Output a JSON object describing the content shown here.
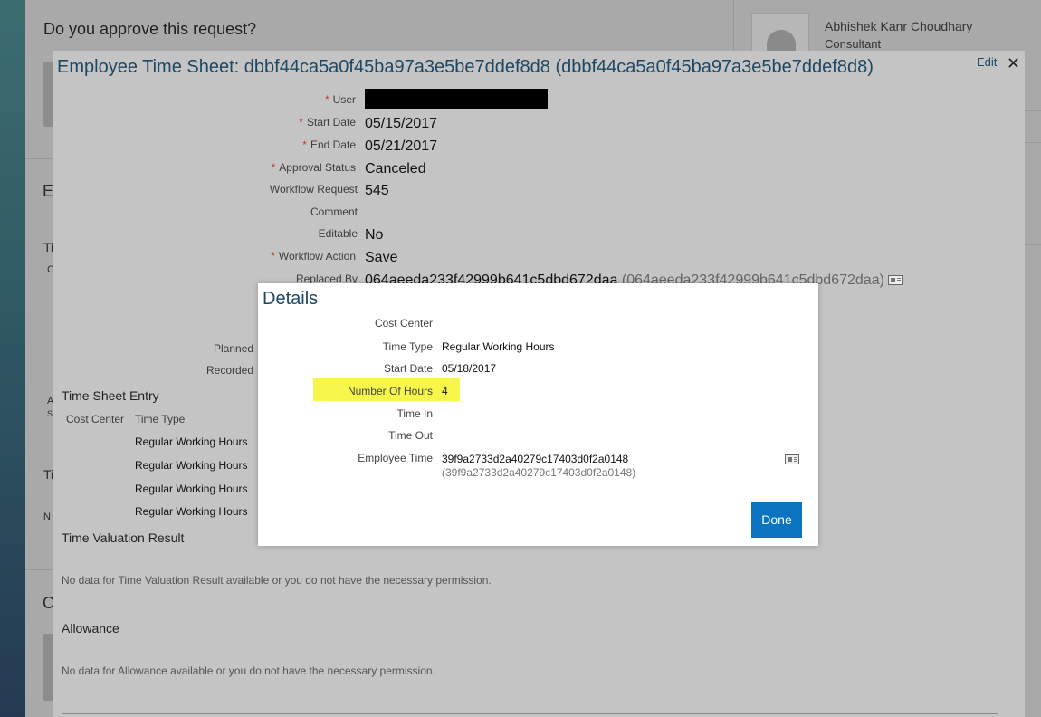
{
  "background": {
    "question": "Do you approve this request?",
    "user_name": "Abhishek Kanr Choudhary",
    "user_role": "Consultant",
    "fragments": [
      "E",
      "Ti",
      "C",
      "A",
      "S",
      "Ti",
      "N",
      "C"
    ]
  },
  "timesheet": {
    "title": "Employee Time Sheet: dbbf44ca5a0f45ba97a3e5be7ddef8d8 (dbbf44ca5a0f45ba97a3e5be7ddef8d8)",
    "edit_label": "Edit",
    "close_glyph": "✕",
    "fields": [
      {
        "label": "User",
        "required": true,
        "value": "/"
      },
      {
        "label": "Start Date",
        "required": true,
        "value": "05/15/2017"
      },
      {
        "label": "End Date",
        "required": true,
        "value": "05/21/2017"
      },
      {
        "label": "Approval Status",
        "required": true,
        "value": "Canceled"
      },
      {
        "label": "Workflow Request",
        "required": false,
        "value": "545"
      },
      {
        "label": "Comment",
        "required": false,
        "value": ""
      },
      {
        "label": "Editable",
        "required": false,
        "value": "No"
      },
      {
        "label": "Workflow Action",
        "required": true,
        "value": "Save"
      },
      {
        "label": "Replaced By",
        "required": false,
        "value": "064aeeda233f42999b641c5dbd672daa",
        "secondary": "(064aeeda233f42999b641c5dbd672daa)"
      }
    ],
    "planned_label": "Planned",
    "recorded_label": "Recorded",
    "entry_section": {
      "title": "Time Sheet Entry",
      "columns": [
        "Cost Center",
        "Time Type"
      ],
      "rows": [
        "Regular Working Hours",
        "Regular Working Hours",
        "Regular Working Hours",
        "Regular Working Hours"
      ]
    },
    "valuation_section": {
      "title": "Time Valuation Result",
      "empty": "No data for Time Valuation Result available or you do not have the necessary permission."
    },
    "allowance_section": {
      "title": "Allowance",
      "empty": "No data for Allowance available or you do not have the necessary permission."
    }
  },
  "details": {
    "title": "Details",
    "fields": [
      {
        "label": "Cost Center",
        "value": ""
      },
      {
        "label": "Time Type",
        "value": "Regular Working Hours"
      },
      {
        "label": "Start Date",
        "value": "05/18/2017"
      },
      {
        "label": "Number Of Hours",
        "value": "4",
        "highlighted": true
      },
      {
        "label": "Time In",
        "value": ""
      },
      {
        "label": "Time Out",
        "value": ""
      },
      {
        "label": "Employee Time",
        "value": "39f9a2733d2a40279c17403d0f2a0148",
        "secondary": "(39f9a2733d2a40279c17403d0f2a0148)"
      }
    ],
    "highlight_color": "#f6f74a",
    "done_label": "Done",
    "done_color": "#0a74c0"
  }
}
